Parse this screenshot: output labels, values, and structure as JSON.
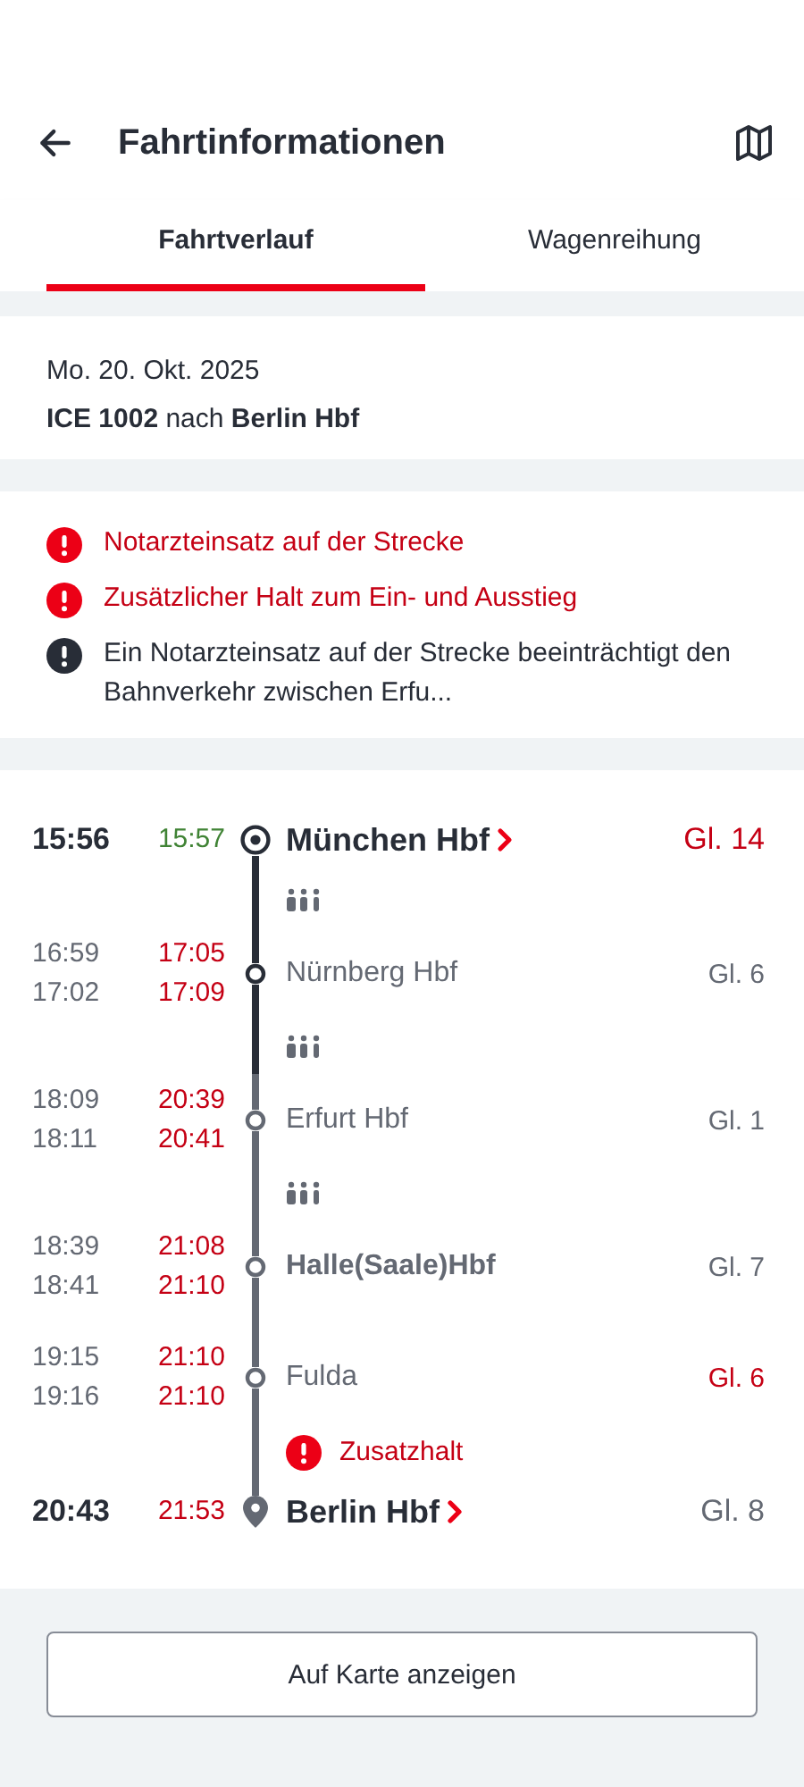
{
  "header": {
    "title": "Fahrtinformationen"
  },
  "tabs": [
    {
      "label": "Fahrtverlauf",
      "selected": true
    },
    {
      "label": "Wagenreihung",
      "selected": false
    }
  ],
  "trip": {
    "date": "Mo. 20. Okt. 2025",
    "train": "**ICE 1002** nach **Berlin Hbf**"
  },
  "messages": [
    {
      "kind": "alert",
      "text": "Notarzteinsatz auf der Strecke"
    },
    {
      "kind": "alert",
      "text": "Zusätzlicher Halt zum Ein- und Ausstieg"
    },
    {
      "kind": "info",
      "text": "Ein Notarzteinsatz auf der Strecke beeinträchtigt den Bahnverkehr zwischen Erfu..."
    }
  ],
  "stops": [
    {
      "kind": "origin",
      "name": "München Hbf",
      "link": true,
      "emphasis": true,
      "times": [
        {
          "planned": "15:56",
          "actual": "15:57"
        }
      ],
      "late": false,
      "platform": "Gl. 14",
      "platform_changed": true,
      "passed": true,
      "occupancy": true
    },
    {
      "kind": "stop",
      "name": "Nürnberg Hbf",
      "link": false,
      "emphasis": false,
      "times": [
        {
          "planned": "16:59",
          "actual": "17:05"
        },
        {
          "planned": "17:02",
          "actual": "17:09"
        }
      ],
      "late": true,
      "platform": "Gl. 6",
      "platform_changed": false,
      "passed": true,
      "occupancy": true
    },
    {
      "kind": "stop",
      "name": "Erfurt Hbf",
      "link": false,
      "emphasis": false,
      "times": [
        {
          "planned": "18:09",
          "actual": "20:39"
        },
        {
          "planned": "18:11",
          "actual": "20:41"
        }
      ],
      "late": true,
      "platform": "Gl. 1",
      "platform_changed": false,
      "passed": false,
      "occupancy": true
    },
    {
      "kind": "stop",
      "name": "Halle(Saale)Hbf",
      "link": false,
      "emphasis": true,
      "times": [
        {
          "planned": "18:39",
          "actual": "21:08"
        },
        {
          "planned": "18:41",
          "actual": "21:10"
        }
      ],
      "late": true,
      "platform": "Gl. 7",
      "platform_changed": false,
      "passed": false,
      "occupancy": false
    },
    {
      "kind": "stop",
      "name": "Fulda",
      "link": false,
      "emphasis": false,
      "times": [
        {
          "planned": "19:15",
          "actual": "21:10"
        },
        {
          "planned": "19:16",
          "actual": "21:10"
        }
      ],
      "late": true,
      "platform": "Gl. 6",
      "platform_changed": true,
      "passed": false,
      "occupancy": false,
      "notice": "Zusatzhalt"
    },
    {
      "kind": "destination",
      "name": "Berlin Hbf",
      "link": true,
      "emphasis": true,
      "times": [
        {
          "planned": "20:43",
          "actual": "21:53"
        }
      ],
      "late": true,
      "platform": "Gl. 8",
      "platform_changed": false,
      "passed": false,
      "occupancy": false
    }
  ],
  "map_button": "Auf Karte anzeigen"
}
